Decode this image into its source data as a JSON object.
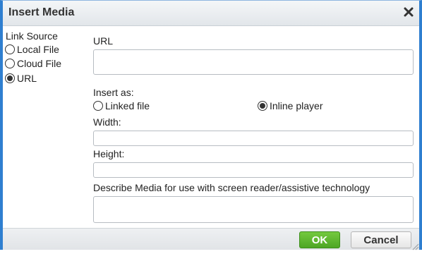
{
  "dialog": {
    "title": "Insert Media",
    "close_icon": "close-icon"
  },
  "link_source": {
    "label": "Link Source",
    "options": [
      {
        "label": "Local File",
        "selected": false
      },
      {
        "label": "Cloud File",
        "selected": false
      },
      {
        "label": "URL",
        "selected": true
      }
    ]
  },
  "url_field": {
    "label": "URL",
    "value": ""
  },
  "insert_as": {
    "label": "Insert as:",
    "options": [
      {
        "label": "Linked file",
        "selected": false
      },
      {
        "label": "Inline player",
        "selected": true
      }
    ]
  },
  "width_field": {
    "label": "Width:",
    "value": ""
  },
  "height_field": {
    "label": "Height:",
    "value": ""
  },
  "description_field": {
    "label": "Describe Media for use with screen reader/assistive technology",
    "value": ""
  },
  "footer": {
    "ok_label": "OK",
    "cancel_label": "Cancel"
  },
  "colors": {
    "frame": "#2f7fd0",
    "ok_button": "#5cb82f"
  }
}
